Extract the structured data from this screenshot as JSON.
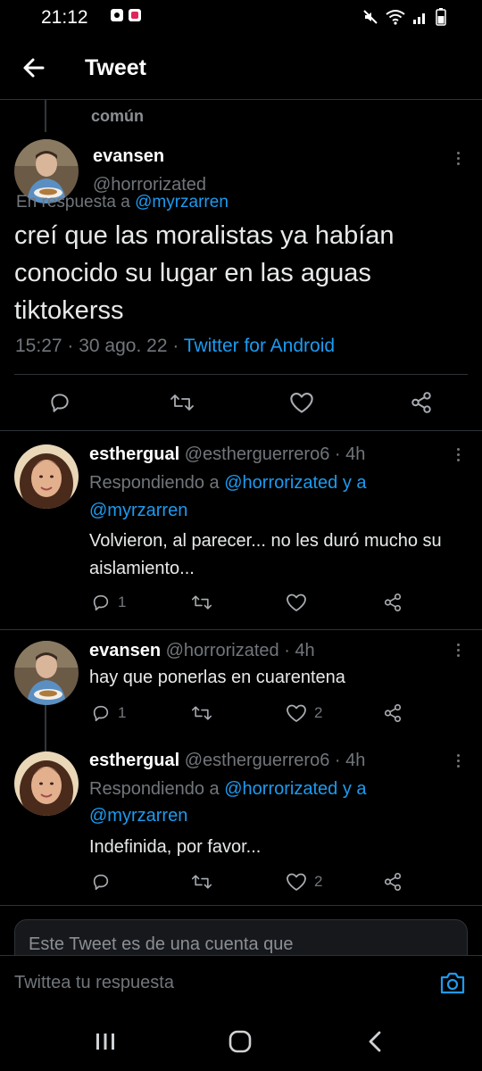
{
  "status_bar": {
    "time": "21:12"
  },
  "header": {
    "title": "Tweet"
  },
  "previous": {
    "partial_text": "común"
  },
  "main_tweet": {
    "name": "evansen",
    "handle": "@horrorizated",
    "reply_prefix": "En respuesta a",
    "reply_target": "@myrzarren",
    "text": "creí que las moralistas ya habían conocido su lugar en las aguas tiktokerss",
    "time": "15:27",
    "date": "30 ago. 22",
    "source": "Twitter for Android"
  },
  "replies": [
    {
      "name": "esthergual",
      "handle": "@estherguerrero6",
      "age": "4h",
      "replying_prefix": "Respondiendo a",
      "replying_targets": "@horrorizated y a",
      "replying_targets_2": "@myrzarren",
      "text": "Volvieron, al parecer... no les duró mucho su aislamiento...",
      "reply_count": "1",
      "retweet_count": "",
      "like_count": ""
    },
    {
      "name": "evansen",
      "handle": "@horrorizated",
      "age": "4h",
      "text": "hay que ponerlas en cuarentena",
      "reply_count": "1",
      "retweet_count": "",
      "like_count": "2"
    },
    {
      "name": "esthergual",
      "handle": "@estherguerrero6",
      "age": "4h",
      "replying_prefix": "Respondiendo a",
      "replying_targets": "@horrorizated y a",
      "replying_targets_2": "@myrzarren",
      "text": "Indefinida, por favor...",
      "reply_count": "",
      "retweet_count": "",
      "like_count": "2"
    }
  ],
  "notice": {
    "text": "Este Tweet es de una cuenta que"
  },
  "compose": {
    "placeholder": "Twittea tu respuesta"
  },
  "colors": {
    "accent": "#1d9bf0",
    "muted": "#71767b",
    "background": "#000000"
  }
}
